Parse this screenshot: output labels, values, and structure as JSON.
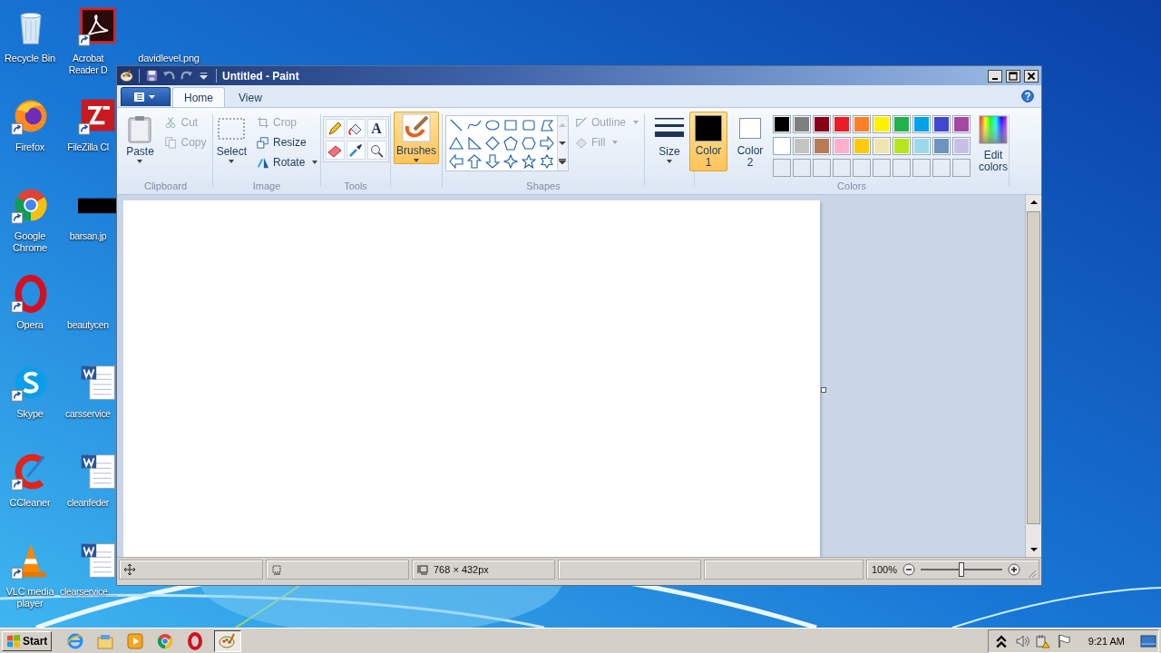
{
  "desktop": {
    "column_1": [
      {
        "label": "Recycle Bin",
        "kind": "recycle",
        "shortcut": false
      },
      {
        "label": "Firefox",
        "kind": "firefox",
        "shortcut": true
      },
      {
        "label": "Google Chrome",
        "kind": "chrome",
        "shortcut": true
      },
      {
        "label": "Opera",
        "kind": "opera",
        "shortcut": true
      },
      {
        "label": "Skype",
        "kind": "skype",
        "shortcut": true
      },
      {
        "label": "CCleaner",
        "kind": "ccleaner",
        "shortcut": true
      },
      {
        "label": "VLC media player",
        "kind": "vlc",
        "shortcut": true
      }
    ],
    "column_2": [
      {
        "label": "Acrobat Reader D",
        "kind": "acrobat",
        "shortcut": true
      },
      {
        "label": "FileZilla Cl",
        "kind": "filezilla",
        "shortcut": true
      },
      {
        "label": "barsan.jp",
        "kind": "thumb",
        "shortcut": false
      },
      {
        "label": "beautycen"
      },
      {
        "label": "carsservice",
        "kind": "word",
        "shortcut": false
      },
      {
        "label": "cleanfeder",
        "kind": "word",
        "shortcut": false
      },
      {
        "label": "clearservice…",
        "kind": "word",
        "shortcut": false
      }
    ],
    "column_3": [
      {
        "label": "davidlevel.png"
      }
    ]
  },
  "paint": {
    "title": "Untitled - Paint",
    "tabs": [
      {
        "label": "Home",
        "selected": true
      },
      {
        "label": "View",
        "selected": false
      }
    ],
    "clipboard": {
      "label": "Clipboard",
      "paste": "Paste",
      "cut": {
        "label": "Cut",
        "disabled": true
      },
      "copy": {
        "label": "Copy",
        "disabled": true
      }
    },
    "image": {
      "label": "Image",
      "select": "Select",
      "crop": {
        "label": "Crop",
        "disabled": true
      },
      "resize": {
        "label": "Resize",
        "disabled": false
      },
      "rotate": {
        "label": "Rotate",
        "disabled": false
      }
    },
    "tools": {
      "label": "Tools",
      "text_tool": "A"
    },
    "brushes": {
      "label": "Brushes",
      "selected": true
    },
    "shapes": {
      "label": "Shapes",
      "outline": {
        "label": "Outline",
        "disabled": true
      },
      "fill": {
        "label": "Fill",
        "disabled": true
      }
    },
    "size": {
      "label": "Size"
    },
    "colors": {
      "label": "Colors",
      "color_1": {
        "label": "Color 1",
        "color": "#000000",
        "selected": true
      },
      "color_2": {
        "label": "Color 2",
        "color": "#ffffff",
        "selected": false
      },
      "palette": [
        {
          "kind": "swatch",
          "color": "#000000"
        },
        {
          "kind": "swatch",
          "color": "#7f7f7f"
        },
        {
          "kind": "swatch",
          "color": "#880015"
        },
        {
          "kind": "swatch",
          "color": "#ed1c24"
        },
        {
          "kind": "swatch",
          "color": "#ff7f27"
        },
        {
          "kind": "swatch",
          "color": "#fff200"
        },
        {
          "kind": "swatch",
          "color": "#22b14c"
        },
        {
          "kind": "swatch",
          "color": "#00a2e8"
        },
        {
          "kind": "swatch",
          "color": "#3f48cc"
        },
        {
          "kind": "swatch",
          "color": "#a349a4"
        },
        {
          "kind": "swatch",
          "color": "#ffffff"
        },
        {
          "kind": "swatch",
          "color": "#c3c3c3"
        },
        {
          "kind": "swatch",
          "color": "#b97a57"
        },
        {
          "kind": "swatch",
          "color": "#ffaec9"
        },
        {
          "kind": "swatch",
          "color": "#ffc90e"
        },
        {
          "kind": "swatch",
          "color": "#efe4b0"
        },
        {
          "kind": "swatch",
          "color": "#b5e61d"
        },
        {
          "kind": "swatch",
          "color": "#99d9ea"
        },
        {
          "kind": "swatch",
          "color": "#7092be"
        },
        {
          "kind": "swatch",
          "color": "#c8bfe7"
        },
        {
          "kind": "empty"
        },
        {
          "kind": "empty"
        },
        {
          "kind": "empty"
        },
        {
          "kind": "empty"
        },
        {
          "kind": "empty"
        },
        {
          "kind": "empty"
        },
        {
          "kind": "empty"
        },
        {
          "kind": "empty"
        },
        {
          "kind": "empty"
        },
        {
          "kind": "empty"
        }
      ],
      "edit": "Edit colors"
    },
    "status": {
      "image_size": "768 × 432px",
      "zoom": "100%",
      "level": 0.5
    }
  },
  "taskbar": {
    "start": "Start",
    "apps": [
      {
        "kind": "ie",
        "active": false
      },
      {
        "kind": "explorer",
        "active": false
      },
      {
        "kind": "media",
        "active": false
      },
      {
        "kind": "chrome",
        "active": false
      },
      {
        "kind": "opera",
        "active": false
      },
      {
        "kind": "paint",
        "active": true
      }
    ],
    "clock": "9:21 AM"
  }
}
